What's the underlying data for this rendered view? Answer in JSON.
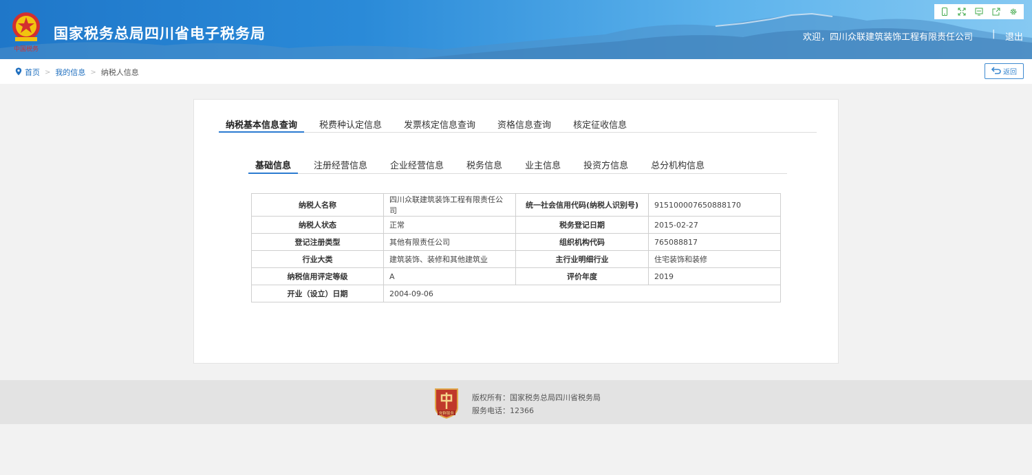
{
  "header": {
    "emblem_text": "中国税务",
    "site_title": "国家税务总局四川省电子税务局",
    "welcome": "欢迎，四川众联建筑装饰工程有限责任公司",
    "separator": "|",
    "logout": "退出",
    "tools": [
      "mobile-icon",
      "fullscreen-icon",
      "monitor-icon",
      "share-icon",
      "settings-icon"
    ]
  },
  "breadcrumb": {
    "items": [
      "首页",
      "我的信息",
      "纳税人信息"
    ],
    "back": "返回"
  },
  "tabs_main": [
    "纳税基本信息查询",
    "税费种认定信息",
    "发票核定信息查询",
    "资格信息查询",
    "核定征收信息"
  ],
  "tabs_sub": [
    "基础信息",
    "注册经营信息",
    "企业经营信息",
    "税务信息",
    "业主信息",
    "投资方信息",
    "总分机构信息"
  ],
  "table": {
    "rows": [
      {
        "l1": "纳税人名称",
        "v1": "四川众联建筑装饰工程有限责任公司",
        "l2": "统一社会信用代码(纳税人识别号)",
        "v2": "915100007650888170"
      },
      {
        "l1": "纳税人状态",
        "v1": "正常",
        "l2": "税务登记日期",
        "v2": "2015-02-27"
      },
      {
        "l1": "登记注册类型",
        "v1": "其他有限责任公司",
        "l2": "组织机构代码",
        "v2": "765088817"
      },
      {
        "l1": "行业大类",
        "v1": "建筑装饰、装修和其他建筑业",
        "l2": "主行业明细行业",
        "v2": "住宅装饰和装修"
      },
      {
        "l1": "纳税信用评定等级",
        "v1": "A",
        "l2": "评价年度",
        "v2": "2019"
      },
      {
        "l1": "开业（设立）日期",
        "v1": "2004-09-06"
      }
    ]
  },
  "footer": {
    "badge_text": "党群服务",
    "copyright": "版权所有：国家税务总局四川省税务局",
    "phone": "服务电话：12366"
  },
  "colors": {
    "header_blue": "#1f77c9",
    "accent": "#2a7ad0",
    "link": "#1f6fbf",
    "badge_red": "#c0392b"
  }
}
